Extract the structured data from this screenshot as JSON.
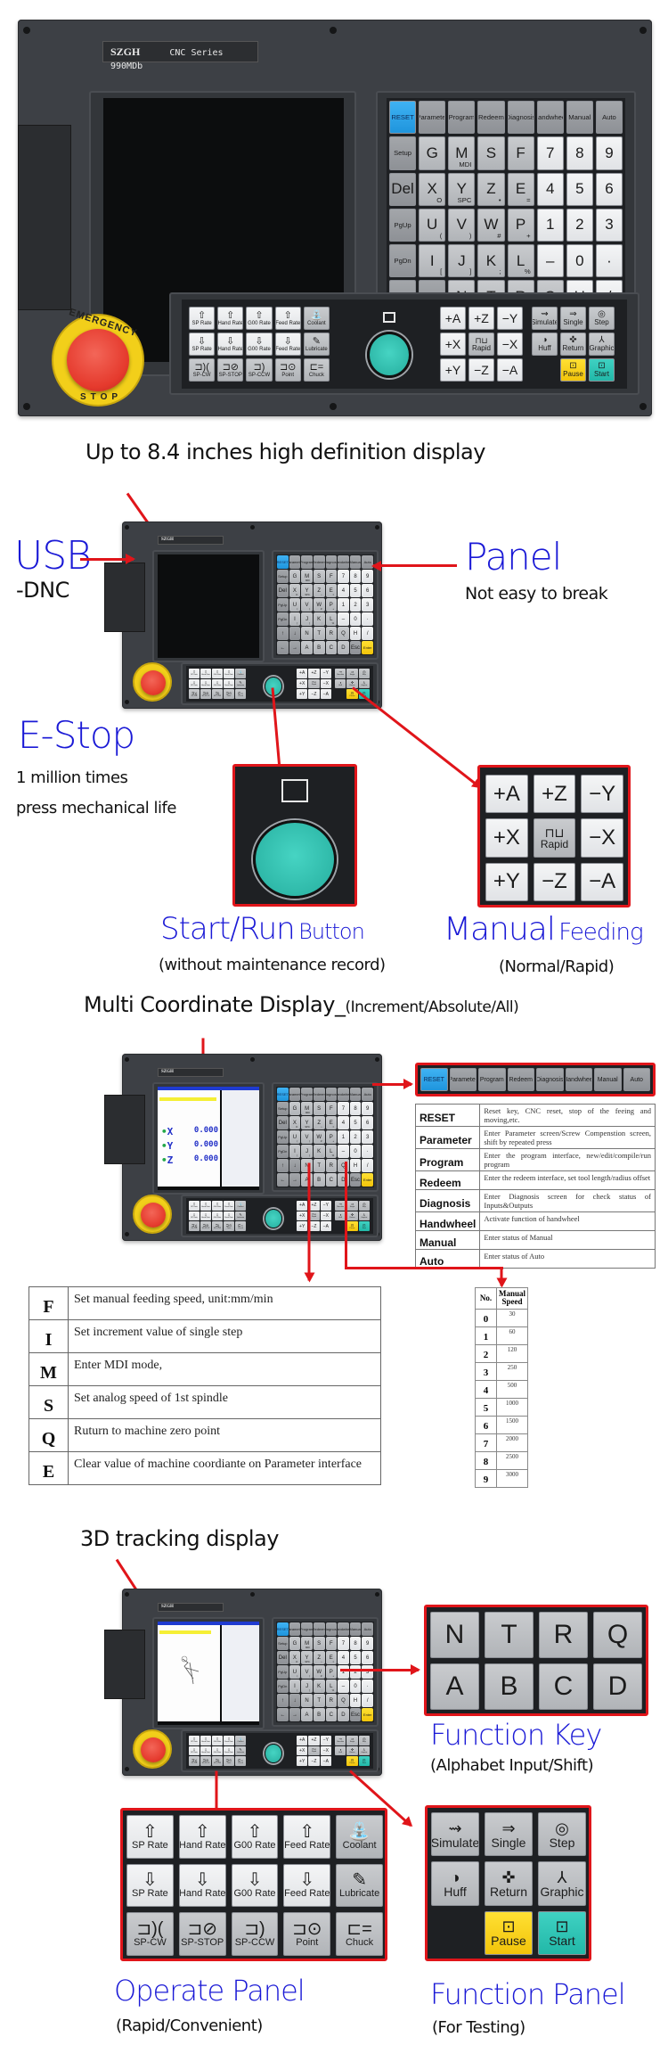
{
  "panel": {
    "brand": "SZGH",
    "model": "CNC Series 990MDb",
    "estop_text_top": "EMERGENCY",
    "estop_text_bottom": "STOP",
    "keypad_rows": [
      [
        {
          "t": "RESET",
          "c": "blue"
        },
        {
          "t": "Parameter",
          "c": "dark"
        },
        {
          "t": "Program",
          "c": "dark"
        },
        {
          "t": "Redeem",
          "c": "dark"
        },
        {
          "t": "Diagnosis",
          "c": "dark"
        },
        {
          "t": "Handwheel",
          "c": "dark"
        },
        {
          "t": "Manual",
          "c": "dark"
        },
        {
          "t": "Auto",
          "c": "dark"
        }
      ],
      [
        {
          "t": "Setup",
          "c": "dark"
        },
        {
          "t": "G"
        },
        {
          "t": "M",
          "s": "MDI"
        },
        {
          "t": "S"
        },
        {
          "t": "F"
        },
        {
          "t": "7",
          "c": "white"
        },
        {
          "t": "8",
          "c": "white"
        },
        {
          "t": "9",
          "c": "white"
        }
      ],
      [
        {
          "t": "Del",
          "c": "dark"
        },
        {
          "t": "X",
          "s": "O"
        },
        {
          "t": "Y",
          "s": "SPC"
        },
        {
          "t": "Z",
          "s": "•"
        },
        {
          "t": "E",
          "s": "="
        },
        {
          "t": "4",
          "c": "white"
        },
        {
          "t": "5",
          "c": "white"
        },
        {
          "t": "6",
          "c": "white"
        }
      ],
      [
        {
          "t": "PgUp",
          "c": "dark"
        },
        {
          "t": "U",
          "s": "("
        },
        {
          "t": "V",
          "s": ")"
        },
        {
          "t": "W",
          "s": "#"
        },
        {
          "t": "P",
          "s": "+"
        },
        {
          "t": "1",
          "c": "white"
        },
        {
          "t": "2",
          "c": "white"
        },
        {
          "t": "3",
          "c": "white"
        }
      ],
      [
        {
          "t": "PgDn",
          "c": "dark"
        },
        {
          "t": "I",
          "s": "["
        },
        {
          "t": "J",
          "s": "]"
        },
        {
          "t": "K",
          "s": ";"
        },
        {
          "t": "L",
          "s": "%"
        },
        {
          "t": "–",
          "c": "white"
        },
        {
          "t": "0",
          "c": "white"
        },
        {
          "t": "·",
          "c": "white"
        }
      ],
      [
        {
          "t": "↑",
          "c": "dark"
        },
        {
          "t": "↓",
          "c": "dark"
        },
        {
          "t": "N"
        },
        {
          "t": "T"
        },
        {
          "t": "R"
        },
        {
          "t": "Q"
        },
        {
          "t": "H",
          "c": "white"
        },
        {
          "t": "/",
          "c": "white"
        }
      ],
      [
        {
          "t": "←",
          "c": "dark"
        },
        {
          "t": "→",
          "c": "dark"
        },
        {
          "t": "A"
        },
        {
          "t": "B"
        },
        {
          "t": "C"
        },
        {
          "t": "D"
        },
        {
          "t": "Esc",
          "c": "dark"
        },
        {
          "t": "Enter",
          "c": "yellow"
        }
      ]
    ],
    "operate_keys": [
      {
        "i": "⇧",
        "t": "SP Rate",
        "c": "white"
      },
      {
        "i": "⇧",
        "t": "Hand Rate",
        "c": "white"
      },
      {
        "i": "⇧",
        "t": "G00 Rate",
        "c": "white"
      },
      {
        "i": "⇧",
        "t": "Feed Rate",
        "c": "white"
      },
      {
        "i": "⛲",
        "t": "Coolant"
      },
      {
        "i": "⇩",
        "t": "SP Rate",
        "c": "white"
      },
      {
        "i": "⇩",
        "t": "Hand Rate",
        "c": "white"
      },
      {
        "i": "⇩",
        "t": "G00 Rate",
        "c": "white"
      },
      {
        "i": "⇩",
        "t": "Feed Rate",
        "c": "white"
      },
      {
        "i": "✎",
        "t": "Lubricate"
      },
      {
        "i": "⊐)(",
        "t": "SP-CW"
      },
      {
        "i": "⊐⊘",
        "t": "SP-STOP"
      },
      {
        "i": "⊐)",
        "t": "SP-CCW"
      },
      {
        "i": "⊐⊙",
        "t": "Point"
      },
      {
        "i": "⊏=",
        "t": "Chuck"
      }
    ],
    "axis_keys": [
      {
        "t": "+A",
        "c": "white"
      },
      {
        "t": "+Z",
        "c": "white"
      },
      {
        "t": "−Y",
        "c": "white"
      },
      {
        "t": "+X",
        "c": "white"
      },
      {
        "t": "Rapid",
        "i": "⊓⊔"
      },
      {
        "t": "−X",
        "c": "white"
      },
      {
        "t": "+Y",
        "c": "white"
      },
      {
        "t": "−Z",
        "c": "white"
      },
      {
        "t": "−A",
        "c": "white"
      }
    ],
    "function_keys": [
      {
        "i": "⇝",
        "t": "Simulate"
      },
      {
        "i": "⇒",
        "t": "Single"
      },
      {
        "i": "◎",
        "t": "Step"
      },
      {
        "i": "◑",
        "t": "Huff"
      },
      {
        "i": "✜",
        "t": "Return"
      },
      {
        "i": "⅄",
        "t": "Graphic"
      },
      {
        "i": "",
        "t": "",
        "c": "empty"
      },
      {
        "i": "⊡",
        "t": "Pause",
        "c": "yellow"
      },
      {
        "i": "⊡",
        "t": "Start",
        "c": "teal"
      }
    ]
  },
  "section_display": {
    "title": "Up to 8.4 inches high definition display",
    "usb_label": "USB",
    "usb_sub": "-DNC",
    "panel_label": "Panel",
    "panel_sub": "Not easy to break"
  },
  "section_estop": {
    "title": "E-Stop",
    "line1": "1 million times",
    "line2": "press mechanical life",
    "start_title_big": "Start/Run",
    "start_title_small": "Button",
    "start_sub": "(without maintenance record)",
    "manual_title_big": "Manual",
    "manual_title_small": "Feeding",
    "manual_sub": "(Normal/Rapid)"
  },
  "section_coord": {
    "title_big": "Multi Coordinate Display_",
    "title_small": "(Increment/Absolute/All)",
    "coords": [
      {
        "axis": "X",
        "value": "0.000"
      },
      {
        "axis": "Y",
        "value": "0.000"
      },
      {
        "axis": "Z",
        "value": "0.000"
      }
    ],
    "mode_keys": [
      "RESET",
      "Parameter",
      "Program",
      "Redeem",
      "Diagnosis",
      "Handwheel",
      "Manual",
      "Auto"
    ],
    "mode_desc": [
      {
        "key": "RESET",
        "desc": "Reset key, CNC reset, stop of the feeing and moving,etc."
      },
      {
        "key": "Parameter",
        "desc": "Enter Parameter screen/Screw Compenstion screen, shift by repeated press"
      },
      {
        "key": "Program",
        "desc": "Enter the program interface, new/edit/compile/run program"
      },
      {
        "key": "Redeem",
        "desc": "Enter the redeem interface, set tool length/radius offset"
      },
      {
        "key": "Diagnosis",
        "desc": "Enter Diagnosis screen for check status of Inputs&Outputs"
      },
      {
        "key": "Handwheel",
        "desc": "Activate function of handwheel"
      },
      {
        "key": "Manual",
        "desc": "Enter status of Manual"
      },
      {
        "key": "Auto",
        "desc": "Enter status of Auto"
      }
    ],
    "letter_desc": [
      {
        "key": "F",
        "desc": "Set manual feeding speed, unit:mm/min"
      },
      {
        "key": "I",
        "desc": "Set increment value of single step"
      },
      {
        "key": "M",
        "desc": "Enter MDI mode,"
      },
      {
        "key": "S",
        "desc": "Set analog speed of 1st spindle"
      },
      {
        "key": "Q",
        "desc": "Ruturn to machine zero point"
      },
      {
        "key": "E",
        "desc": "Clear value of machine coordiante on Parameter interface"
      }
    ],
    "speed_table": {
      "col_no": "No.",
      "col_speed": "Manual Speed",
      "rows": [
        {
          "no": "0",
          "speed": "30"
        },
        {
          "no": "1",
          "speed": "60"
        },
        {
          "no": "2",
          "speed": "120"
        },
        {
          "no": "3",
          "speed": "250"
        },
        {
          "no": "4",
          "speed": "500"
        },
        {
          "no": "5",
          "speed": "1000"
        },
        {
          "no": "6",
          "speed": "1500"
        },
        {
          "no": "7",
          "speed": "2000"
        },
        {
          "no": "8",
          "speed": "2500"
        },
        {
          "no": "9",
          "speed": "3000"
        }
      ]
    }
  },
  "section_3d": {
    "title": "3D tracking display",
    "fkey_letters": [
      "N",
      "T",
      "R",
      "Q",
      "A",
      "B",
      "C",
      "D"
    ],
    "function_key_title": "Function Key",
    "function_key_sub": "(Alphabet Input/Shift)",
    "operate_title": "Operate Panel",
    "operate_sub": "(Rapid/Convenient)",
    "function_panel_title": "Function Panel",
    "function_panel_sub": "(For Testing)"
  }
}
